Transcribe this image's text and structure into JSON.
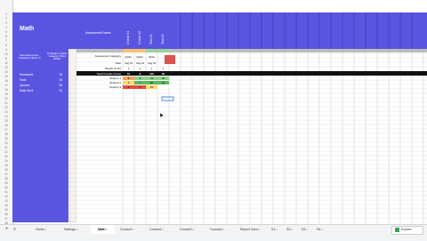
{
  "sheet": {
    "title": "Math",
    "assessment_header_label": "Assessment Name",
    "assessment_columns": [
      "Check #1",
      "Check #2",
      "Test #1",
      "Test #2"
    ]
  },
  "left_panel": {
    "col1_header": "Edit Assessment Categories (Entry 2)",
    "col2_header": "% Weight of Each Category (Total 100%)",
    "categories": [
      {
        "name": "Homework",
        "weight": "15"
      },
      {
        "name": "Tests",
        "weight": "35"
      },
      {
        "name": "Quizzes",
        "weight": "35"
      },
      {
        "name": "Daily Work",
        "weight": "15"
      }
    ]
  },
  "row_labels": {
    "assessment_category": "Assessment Category",
    "date": "Date",
    "weight": "Weight (0-10)",
    "total_points": "Total Possible Points"
  },
  "assessment_cells": {
    "category": [
      "Quizz.",
      "Quizz.",
      "Tests",
      ""
    ],
    "date": [
      "Aug 31",
      "Aug 31",
      "Aug 31",
      ""
    ],
    "weight": [
      "1",
      "1",
      "1",
      "1"
    ],
    "total_points": [
      "10",
      "8",
      "100",
      "50"
    ]
  },
  "students": [
    {
      "name": "Student 1",
      "scores": [
        "8",
        "5",
        "74",
        "45"
      ],
      "colors": [
        "#f6a15a",
        "#8fcf8f",
        "#8fcf8f",
        "#8fcf8f"
      ]
    },
    {
      "name": "Student 2",
      "scores": [
        "6",
        "7",
        "80",
        "44"
      ],
      "colors": [
        "#ffd966",
        "#5cb85c",
        "#5cb85c",
        "#5cb85c"
      ]
    },
    {
      "name": "Student 3",
      "scores": [
        "3",
        "3",
        "62",
        ""
      ],
      "colors": [
        "#e74c3c",
        "#e74c3c",
        "#ffd966",
        "#ffffff"
      ]
    }
  ],
  "tabs": [
    "Home",
    "Settings",
    "Math",
    "Course1",
    "Course2",
    "Course3",
    "Course4",
    "Report Card",
    "S1",
    "S2",
    "S3",
    "S4"
  ],
  "active_tab": "Math",
  "explore_label": "Explore",
  "colors": {
    "header_purple": "#5a55e0",
    "total_row": "#111111"
  }
}
